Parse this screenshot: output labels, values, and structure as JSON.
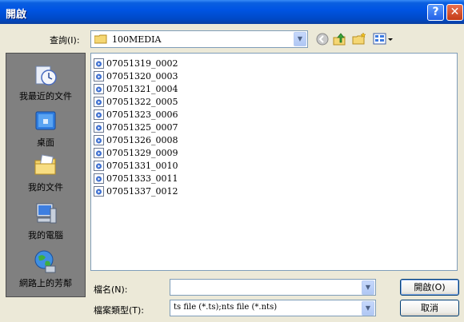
{
  "window": {
    "title": "開啟",
    "help_label": "?",
    "close_label": "✕"
  },
  "toolbar": {
    "lookin_label": "查詢(I):",
    "lookin_value": "100MEDIA",
    "icons": [
      "back-icon",
      "up-folder-icon",
      "new-folder-icon",
      "views-menu-icon"
    ]
  },
  "places": [
    {
      "label": "我最近的文件",
      "icon": "recent-documents-icon"
    },
    {
      "label": "桌面",
      "icon": "desktop-icon"
    },
    {
      "label": "我的文件",
      "icon": "my-documents-icon"
    },
    {
      "label": "我的電腦",
      "icon": "my-computer-icon"
    },
    {
      "label": "網路上的芳鄰",
      "icon": "network-places-icon"
    }
  ],
  "files": [
    "07051319_0002",
    "07051320_0003",
    "07051321_0004",
    "07051322_0005",
    "07051323_0006",
    "07051325_0007",
    "07051326_0008",
    "07051329_0009",
    "07051331_0010",
    "07051333_0011",
    "07051337_0012"
  ],
  "bottom": {
    "filename_label": "檔名(N):",
    "filename_value": "",
    "filetype_label": "檔案類型(T):",
    "filetype_value": "ts file (*.ts);nts file (*.nts)",
    "open_label": "開啟(O)",
    "cancel_label": "取消"
  },
  "colors": {
    "titlebar": "#0054e3",
    "dialog_bg": "#ece9d8",
    "places_bg": "#808080",
    "border": "#7f9db9"
  }
}
